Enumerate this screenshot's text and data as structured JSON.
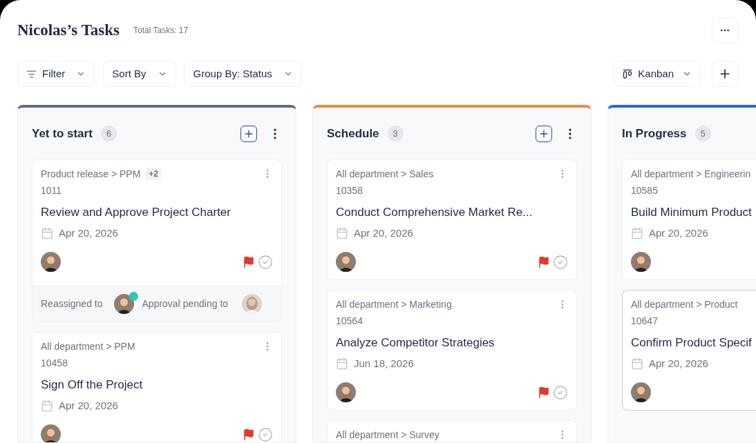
{
  "header": {
    "title": "Nicolas’s Tasks",
    "total": "Total Tasks: 17"
  },
  "toolbar": {
    "filters": [
      {
        "label": "Filter",
        "kind": "filter"
      },
      {
        "label": "Sort By",
        "kind": "plain"
      },
      {
        "label": "Group By: Status",
        "kind": "plain"
      }
    ],
    "view": "Kanban"
  },
  "columns": [
    {
      "title": "Yet to start",
      "count": "6",
      "color": "#5f6b85",
      "cards": [
        {
          "path": "Product release > PPM",
          "extra": "+2",
          "id": "1011",
          "title": "Review and Approve Project Charter",
          "date": "Apr 20, 2026",
          "highlighted": false,
          "footer": {
            "reassigned": "Reassigned to",
            "online": true,
            "pending": "Approval pending to"
          }
        },
        {
          "path": "All department > PPM",
          "id": "10458",
          "title": "Sign Off the Project",
          "date": "Apr 20, 2026",
          "highlighted": false
        }
      ]
    },
    {
      "title": "Schedule",
      "count": "3",
      "color": "#f0883e",
      "cards": [
        {
          "path": "All department > Sales",
          "id": "10358",
          "title": "Conduct Comprehensive Market Re...",
          "date": "Apr 20, 2026",
          "highlighted": false
        },
        {
          "path": "All department > Marketing",
          "id": "10564",
          "title": "Analyze Competitor Strategies",
          "date": "Jun 18, 2026",
          "highlighted": false
        },
        {
          "path": "All department > Survey",
          "highlighted": false
        }
      ]
    },
    {
      "title": "In Progress",
      "count": "5",
      "color": "#2563eb",
      "cards": [
        {
          "path": "All department > Engineerin",
          "id": "10585",
          "title": "Build Minimum Product",
          "date": "Apr 20, 2026",
          "highlighted": false
        },
        {
          "path": "All department > Product",
          "id": "10647",
          "title": "Confirm Product Specif",
          "date": "Apr 20, 2026",
          "highlighted": true
        }
      ]
    }
  ]
}
